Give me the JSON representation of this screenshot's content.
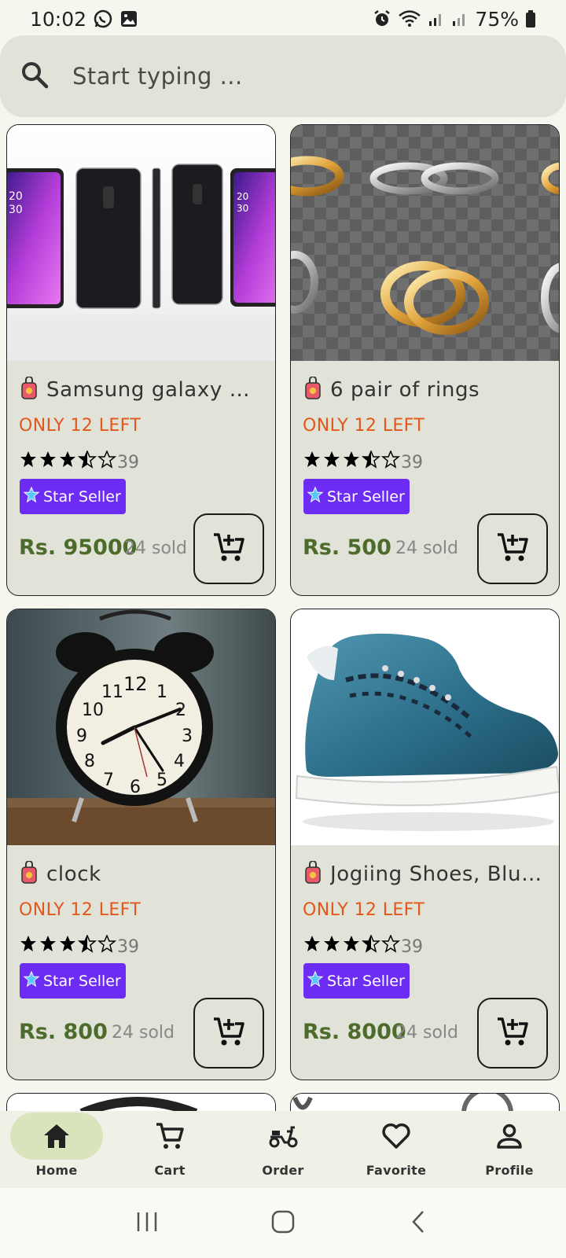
{
  "status_bar": {
    "time": "10:02",
    "battery": "75%"
  },
  "search": {
    "placeholder": "Start typing ..."
  },
  "products": [
    {
      "title": "Samsung galaxy not...",
      "stock": "ONLY 12 LEFT",
      "rating": 3.5,
      "reviews": "39",
      "badge": "Star Seller",
      "price": "Rs. 95000",
      "sold": "24 sold"
    },
    {
      "title": "6 pair of rings",
      "stock": "ONLY 12 LEFT",
      "rating": 3.5,
      "reviews": "39",
      "badge": "Star Seller",
      "price": "Rs. 500",
      "sold": "24 sold"
    },
    {
      "title": "clock",
      "stock": "ONLY 12 LEFT",
      "rating": 3.5,
      "reviews": "39",
      "badge": "Star Seller",
      "price": "Rs. 800",
      "sold": "24 sold"
    },
    {
      "title": "Jogiing Shoes, Blue ...",
      "stock": "ONLY 12 LEFT",
      "rating": 3.5,
      "reviews": "39",
      "badge": "Star Seller",
      "price": "Rs. 8000",
      "sold": "24 sold"
    }
  ],
  "bottom_nav": {
    "items": [
      {
        "label": "Home",
        "icon": "home-icon",
        "active": true
      },
      {
        "label": "Cart",
        "icon": "cart-icon"
      },
      {
        "label": "Order",
        "icon": "scooter-icon"
      },
      {
        "label": "Favorite",
        "icon": "heart-icon"
      },
      {
        "label": "Profile",
        "icon": "person-icon"
      }
    ]
  },
  "colors": {
    "accent": "#6d2cf4",
    "price": "#4d6b2a",
    "stock": "#e4571b",
    "nav_active": "#d9e4bd"
  }
}
